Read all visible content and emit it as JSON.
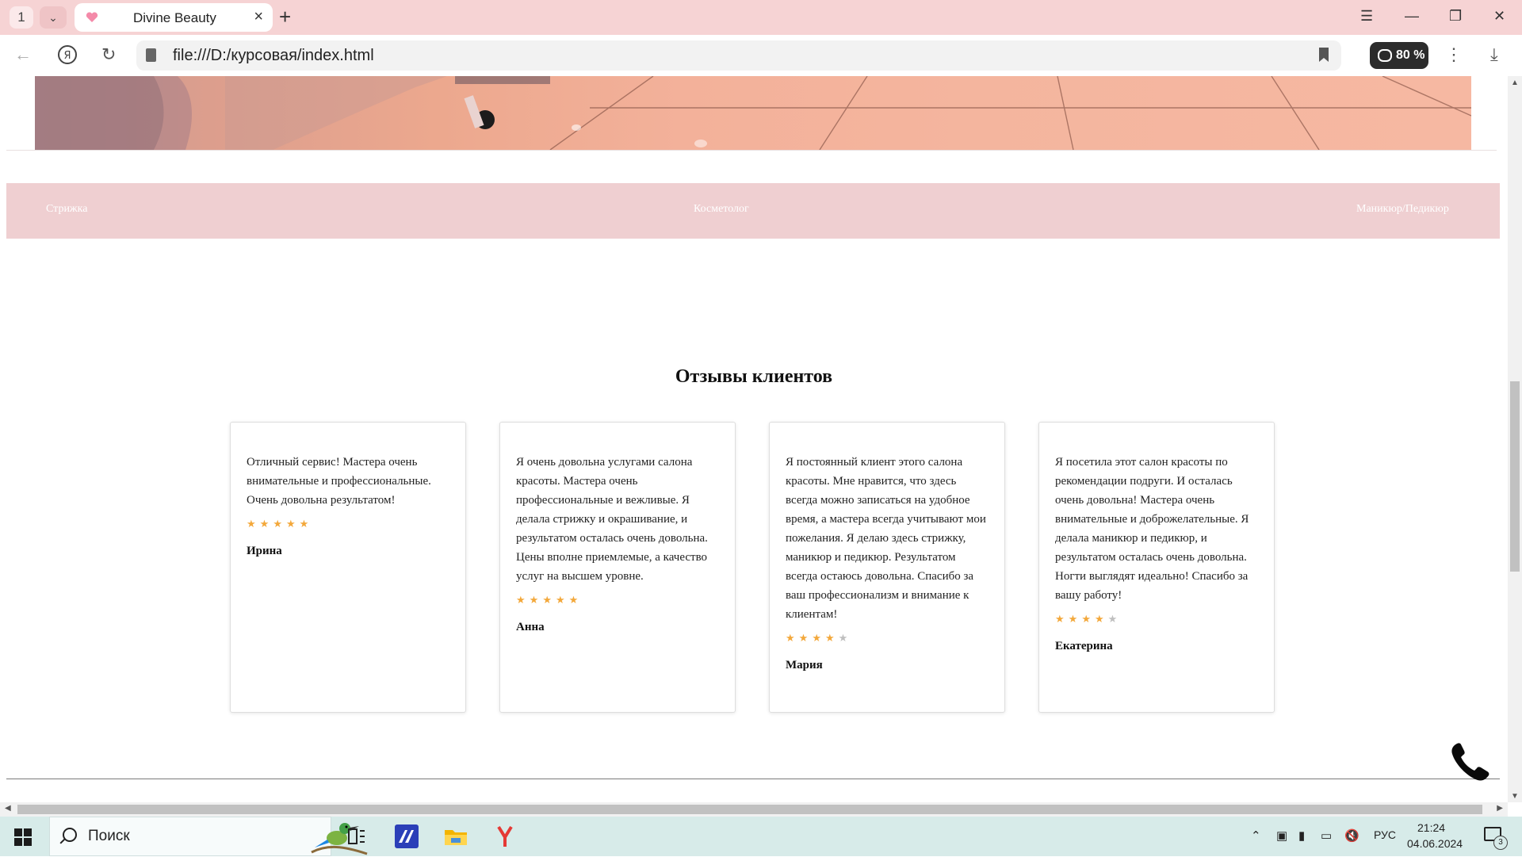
{
  "browser": {
    "tab_count": "1",
    "tab_title": "Divine Beauty",
    "address": "file:///D:/курсовая/index.html",
    "voice_zoom": "80 %"
  },
  "page": {
    "services": [
      "Стрижка",
      "Косметолог",
      "Маникюр/Педикюр"
    ],
    "reviews_title": "Отзывы клиентов",
    "reviews": [
      {
        "text": "Отличный сервис! Мастера очень внимательные и профессиональные. Очень довольна результатом!",
        "rating": 5,
        "author": "Ирина"
      },
      {
        "text": "Я очень довольна услугами салона красоты. Мастера очень профессиональные и вежливые. Я делала стрижку и окрашивание, и результатом осталась очень довольна. Цены вполне приемлемые, а качество услуг на высшем уровне.",
        "rating": 5,
        "author": "Анна"
      },
      {
        "text": "Я постоянный клиент этого салона красоты. Мне нравится, что здесь всегда можно записаться на удобное время, а мастера всегда учитывают мои пожелания. Я делаю здесь стрижку, маникюр и педикюр. Результатом всегда остаюсь довольна. Спасибо за ваш профессионализм и внимание к клиентам!",
        "rating": 4,
        "author": "Мария"
      },
      {
        "text": "Я посетила этот салон красоты по рекомендации подруги. И осталась очень довольна! Мастера очень внимательные и доброжелательные. Я делала маникюр и педикюр, и результатом осталась очень довольна. Ногти выглядят идеально! Спасибо за вашу работу!",
        "rating": 4,
        "author": "Екатерина"
      }
    ],
    "star_max": 5,
    "star_char": "★",
    "star_color": "#f3a83b",
    "accent_pink": "#efcfd1"
  },
  "taskbar": {
    "search_placeholder": "Поиск",
    "language": "РУС",
    "time": "21:24",
    "date": "04.06.2024",
    "notifications": "3"
  },
  "icons": [
    "browser-tabs-icon",
    "heart-favicon-icon",
    "close-icon",
    "plus-icon",
    "menu-icon",
    "minimize-icon",
    "restore-icon",
    "back-arrow-icon",
    "yandex-icon",
    "reload-icon",
    "page-icon",
    "bookmark-icon",
    "voice-bubble-icon",
    "more-vertical-icon",
    "download-icon",
    "phone-icon",
    "windows-start-icon",
    "search-icon",
    "task-view-icon",
    "chevron-up-icon",
    "speaker-muted-icon",
    "battery-icon",
    "network-icon",
    "notification-icon"
  ]
}
